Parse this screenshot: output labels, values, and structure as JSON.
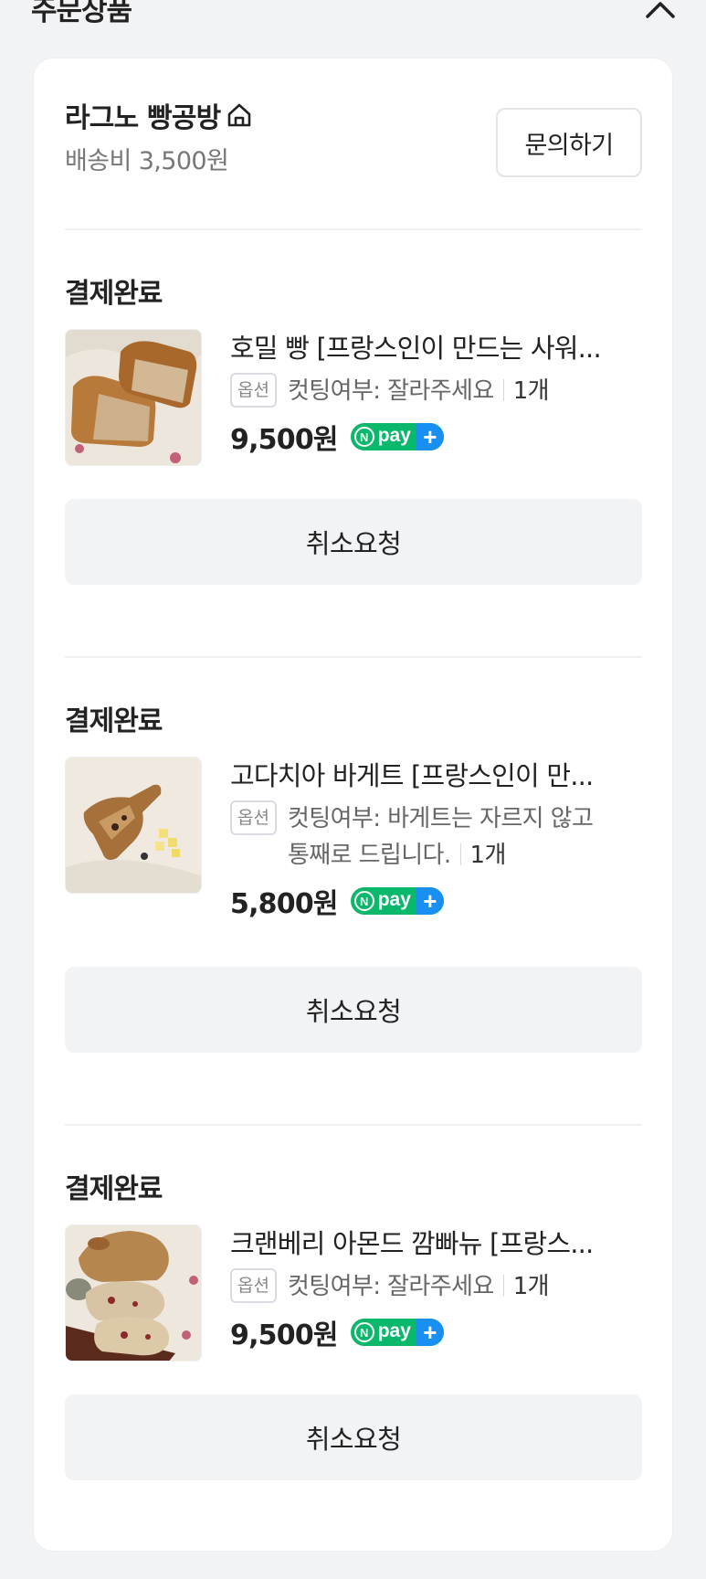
{
  "header": {
    "title": "주문상품",
    "collapse_icon": "chevron-up-icon"
  },
  "seller": {
    "name": "라그노 빵공방",
    "home_icon": "home-icon",
    "shipping": "배송비 3,500원",
    "inquiry_label": "문의하기"
  },
  "items": [
    {
      "status": "결제완료",
      "name": "호밀 빵 [프랑스인이 만드는 사워...",
      "option_badge": "옵션",
      "option_lines": [
        "컷팅여부: 잘라주세요"
      ],
      "qty": "1개",
      "price": "9,500원",
      "pay_badge": "Npay+",
      "cancel_label": "취소요청"
    },
    {
      "status": "결제완료",
      "name": "고다치아 바게트 [프랑스인이 만...",
      "option_badge": "옵션",
      "option_lines": [
        "컷팅여부: 바게트는 자르지 않고",
        "통째로 드립니다."
      ],
      "qty": "1개",
      "price": "5,800원",
      "pay_badge": "Npay+",
      "cancel_label": "취소요청"
    },
    {
      "status": "결제완료",
      "name": "크랜베리 아몬드 깜빠뉴 [프랑스...",
      "option_badge": "옵션",
      "option_lines": [
        "컷팅여부: 잘라주세요"
      ],
      "qty": "1개",
      "price": "9,500원",
      "pay_badge": "Npay+",
      "cancel_label": "취소요청"
    }
  ]
}
